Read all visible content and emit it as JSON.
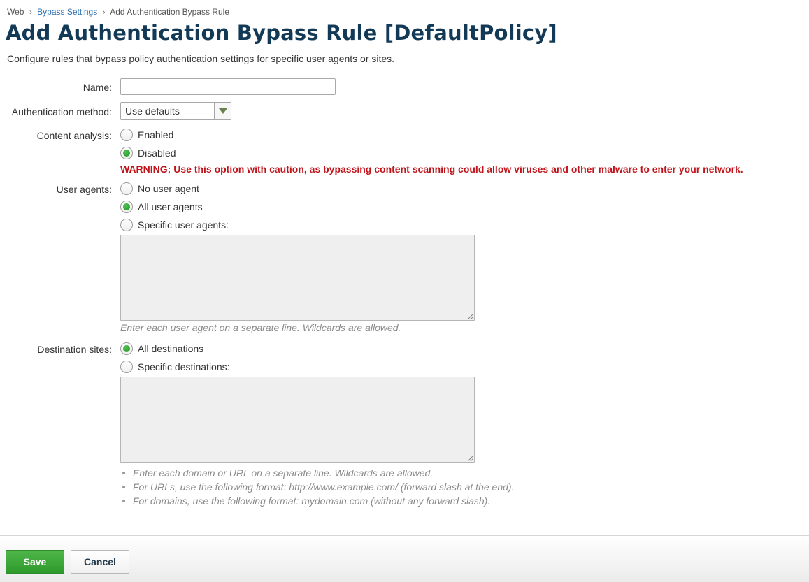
{
  "breadcrumb": {
    "root": "Web",
    "parent": "Bypass Settings",
    "current": "Add Authentication Bypass Rule",
    "separator": "›"
  },
  "page": {
    "title": "Add Authentication Bypass Rule [DefaultPolicy]",
    "description": "Configure rules that bypass policy authentication settings for specific user agents or sites."
  },
  "form": {
    "name": {
      "label": "Name:",
      "value": ""
    },
    "auth_method": {
      "label": "Authentication method:",
      "selected": "Use defaults"
    },
    "content_analysis": {
      "label": "Content analysis:",
      "options": [
        {
          "label": "Enabled",
          "checked": false
        },
        {
          "label": "Disabled",
          "checked": true
        }
      ],
      "warning": "WARNING: Use this option with caution, as bypassing content scanning could allow viruses and other malware to enter your network."
    },
    "user_agents": {
      "label": "User agents:",
      "options": [
        {
          "label": "No user agent",
          "checked": false
        },
        {
          "label": "All user agents",
          "checked": true
        },
        {
          "label": "Specific user agents:",
          "checked": false
        }
      ],
      "textarea_value": "",
      "hint": "Enter each user agent on a separate line. Wildcards are allowed."
    },
    "destinations": {
      "label": "Destination sites:",
      "options": [
        {
          "label": "All destinations",
          "checked": true
        },
        {
          "label": "Specific destinations:",
          "checked": false
        }
      ],
      "textarea_value": "",
      "hints": [
        "Enter each domain or URL on a separate line. Wildcards are allowed.",
        "For URLs, use the following format: http://www.example.com/ (forward slash at the end).",
        "For domains, use the following format: mydomain.com (without any forward slash)."
      ]
    }
  },
  "footer": {
    "save_label": "Save",
    "cancel_label": "Cancel"
  },
  "colors": {
    "accent_green": "#2e9a2b",
    "warning_red": "#c0141a",
    "title_navy": "#123a57",
    "link_blue": "#2a6fb0"
  }
}
